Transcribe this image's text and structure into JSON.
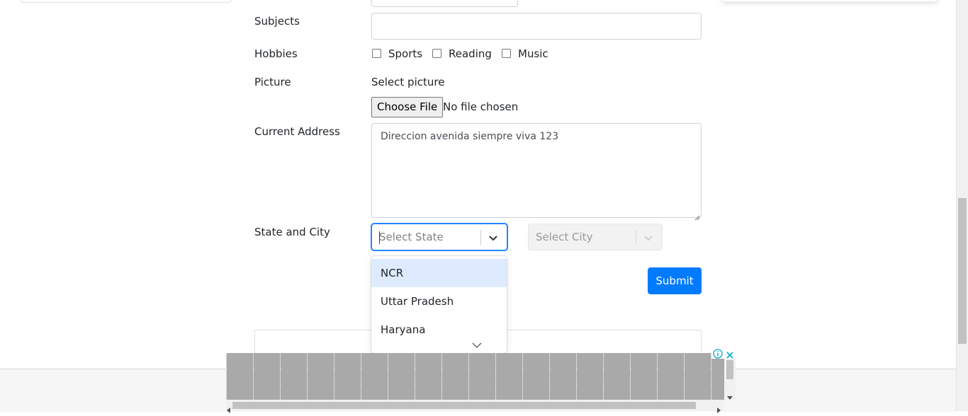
{
  "form": {
    "subjects_label": "Subjects",
    "subjects_value": "",
    "hobbies_label": "Hobbies",
    "hobbies": [
      {
        "label": "Sports",
        "checked": false
      },
      {
        "label": "Reading",
        "checked": false
      },
      {
        "label": "Music",
        "checked": false
      }
    ],
    "picture_label": "Picture",
    "picture_hint": "Select picture",
    "choose_file_label": "Choose File",
    "no_file_text": "No file chosen",
    "address_label": "Current Address",
    "address_value": "Direccion avenida siempre viva 123",
    "state_city_label": "State and City",
    "state_placeholder": "Select State",
    "city_placeholder": "Select City",
    "state_options": [
      "NCR",
      "Uttar Pradesh",
      "Haryana"
    ],
    "submit_label": "Submit"
  },
  "ad": {
    "info_icon": "info-icon",
    "close_icon": "close-icon"
  },
  "colors": {
    "primary": "#007bff",
    "select_focus": "#2684ff",
    "option_focus": "#deebff"
  }
}
